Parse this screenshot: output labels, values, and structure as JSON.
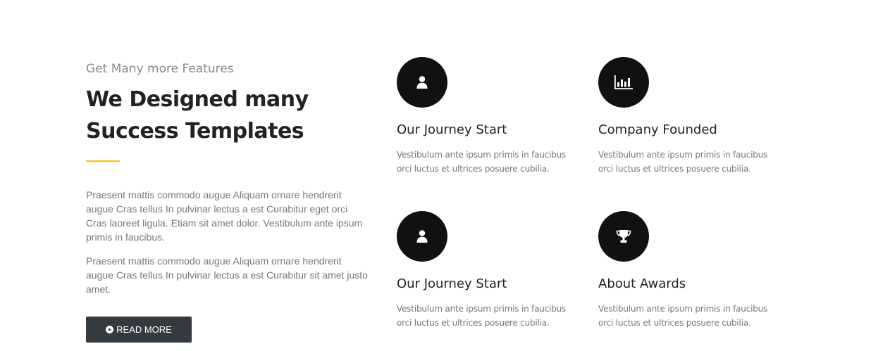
{
  "intro": {
    "eyebrow": "Get Many more Features",
    "headline_line1": "We Designed many",
    "headline_line2": "Success Templates",
    "paragraph1": "Praesent mattis commodo augue Aliquam ornare hendrerit augue Cras tellus In pulvinar lectus a est Curabitur eget orci Cras laoreet ligula. Etiam sit amet dolor. Vestibulum ante ipsum primis in faucibus.",
    "paragraph2": "Praesent mattis commodo augue Aliquam ornare hendrerit augue Cras tellus In pulvinar lectus a est Curabitur sit amet justo amet.",
    "button_label": "READ MORE",
    "accent_color": "#f2c21b"
  },
  "features": [
    {
      "icon": "user-icon",
      "title": "Our Journey Start",
      "description": "Vestibulum ante ipsum primis in faucibus orci luctus et ultrices posuere cubilia."
    },
    {
      "icon": "bar-chart-icon",
      "title": "Company Founded",
      "description": "Vestibulum ante ipsum primis in faucibus orci luctus et ultrices posuere cubilia."
    },
    {
      "icon": "user-icon",
      "title": "Our Journey Start",
      "description": "Vestibulum ante ipsum primis in faucibus orci luctus et ultrices posuere cubilia."
    },
    {
      "icon": "trophy-icon",
      "title": "About Awards",
      "description": "Vestibulum ante ipsum primis in faucibus orci luctus et ultrices posuere cubilia."
    }
  ],
  "colors": {
    "icon_circle": "#111111",
    "button_bg": "#353a41",
    "heading": "#222222",
    "body_text": "#777777"
  }
}
